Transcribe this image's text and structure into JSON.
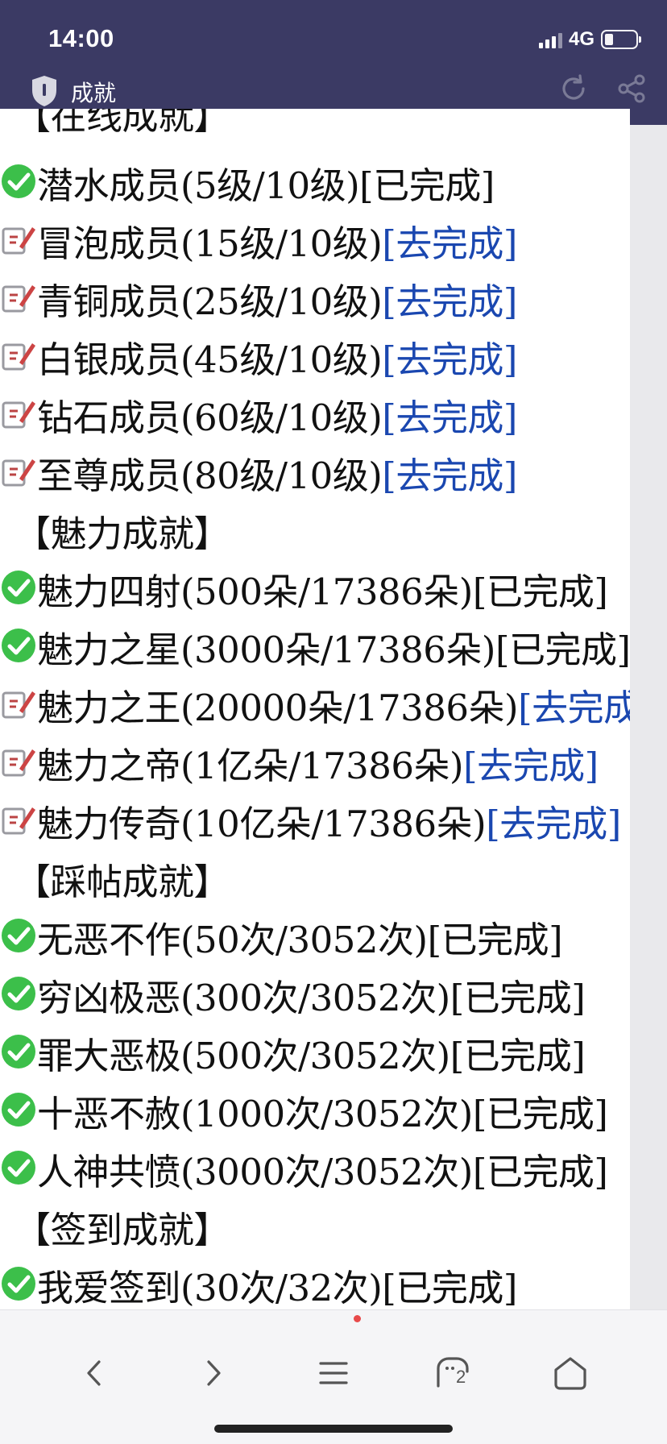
{
  "status_bar": {
    "time": "14:00",
    "network": "4G"
  },
  "header": {
    "title": "成就"
  },
  "lines": [
    {
      "kind": "section",
      "text": "【在线成就】"
    },
    {
      "kind": "item",
      "icon": "check-icon",
      "text": "潜水成员(5级/10级)",
      "action": "[已完成]"
    },
    {
      "kind": "item",
      "icon": "edit-icon",
      "text": "冒泡成员(15级/10级)",
      "action": "[去完成]"
    },
    {
      "kind": "item",
      "icon": "edit-icon",
      "text": "青铜成员(25级/10级)",
      "action": "[去完成]"
    },
    {
      "kind": "item",
      "icon": "edit-icon",
      "text": "白银成员(45级/10级)",
      "action": "[去完成]"
    },
    {
      "kind": "item",
      "icon": "edit-icon",
      "text": "钻石成员(60级/10级)",
      "action": "[去完成]"
    },
    {
      "kind": "item",
      "icon": "edit-icon",
      "text": "至尊成员(80级/10级)",
      "action": "[去完成]"
    },
    {
      "kind": "section",
      "text": "【魅力成就】"
    },
    {
      "kind": "item",
      "icon": "check-icon",
      "text": "魅力四射(500朵/17386朵)",
      "action": "[已完成]"
    },
    {
      "kind": "item",
      "icon": "check-icon",
      "text": "魅力之星(3000朵/17386朵)",
      "action": "[已完成]"
    },
    {
      "kind": "item",
      "icon": "edit-icon",
      "text": "魅力之王(20000朵/17386朵)",
      "action": "[去完成]"
    },
    {
      "kind": "item",
      "icon": "edit-icon",
      "text": "魅力之帝(1亿朵/17386朵)",
      "action": "[去完成]"
    },
    {
      "kind": "item",
      "icon": "edit-icon",
      "text": "魅力传奇(10亿朵/17386朵)",
      "action": "[去完成]"
    },
    {
      "kind": "section",
      "text": "【踩帖成就】"
    },
    {
      "kind": "item",
      "icon": "check-icon",
      "text": "无恶不作(50次/3052次)",
      "action": "[已完成]"
    },
    {
      "kind": "item",
      "icon": "check-icon",
      "text": "穷凶极恶(300次/3052次)",
      "action": "[已完成]"
    },
    {
      "kind": "item",
      "icon": "check-icon",
      "text": "罪大恶极(500次/3052次)",
      "action": "[已完成]"
    },
    {
      "kind": "item",
      "icon": "check-icon",
      "text": "十恶不赦(1000次/3052次)",
      "action": "[已完成]"
    },
    {
      "kind": "item",
      "icon": "check-icon",
      "text": "人神共愤(3000次/3052次)",
      "action": "[已完成]"
    },
    {
      "kind": "section",
      "text": "【签到成就】"
    },
    {
      "kind": "item",
      "icon": "check-icon",
      "text": "我爱签到(30次/32次)",
      "action": "[已完成]"
    }
  ],
  "bottom_nav": [
    {
      "name": "back-button",
      "icon": "chevron-left-icon"
    },
    {
      "name": "forward-button",
      "icon": "chevron-right-icon"
    },
    {
      "name": "menu-button",
      "icon": "menu-icon"
    },
    {
      "name": "tabs-button",
      "icon": "tabs-icon",
      "count": "2"
    },
    {
      "name": "home-button",
      "icon": "home-icon"
    }
  ],
  "colors": {
    "header_bg": "#3b3a64",
    "link": "#1a47b0",
    "check": "#3cbf4a"
  }
}
